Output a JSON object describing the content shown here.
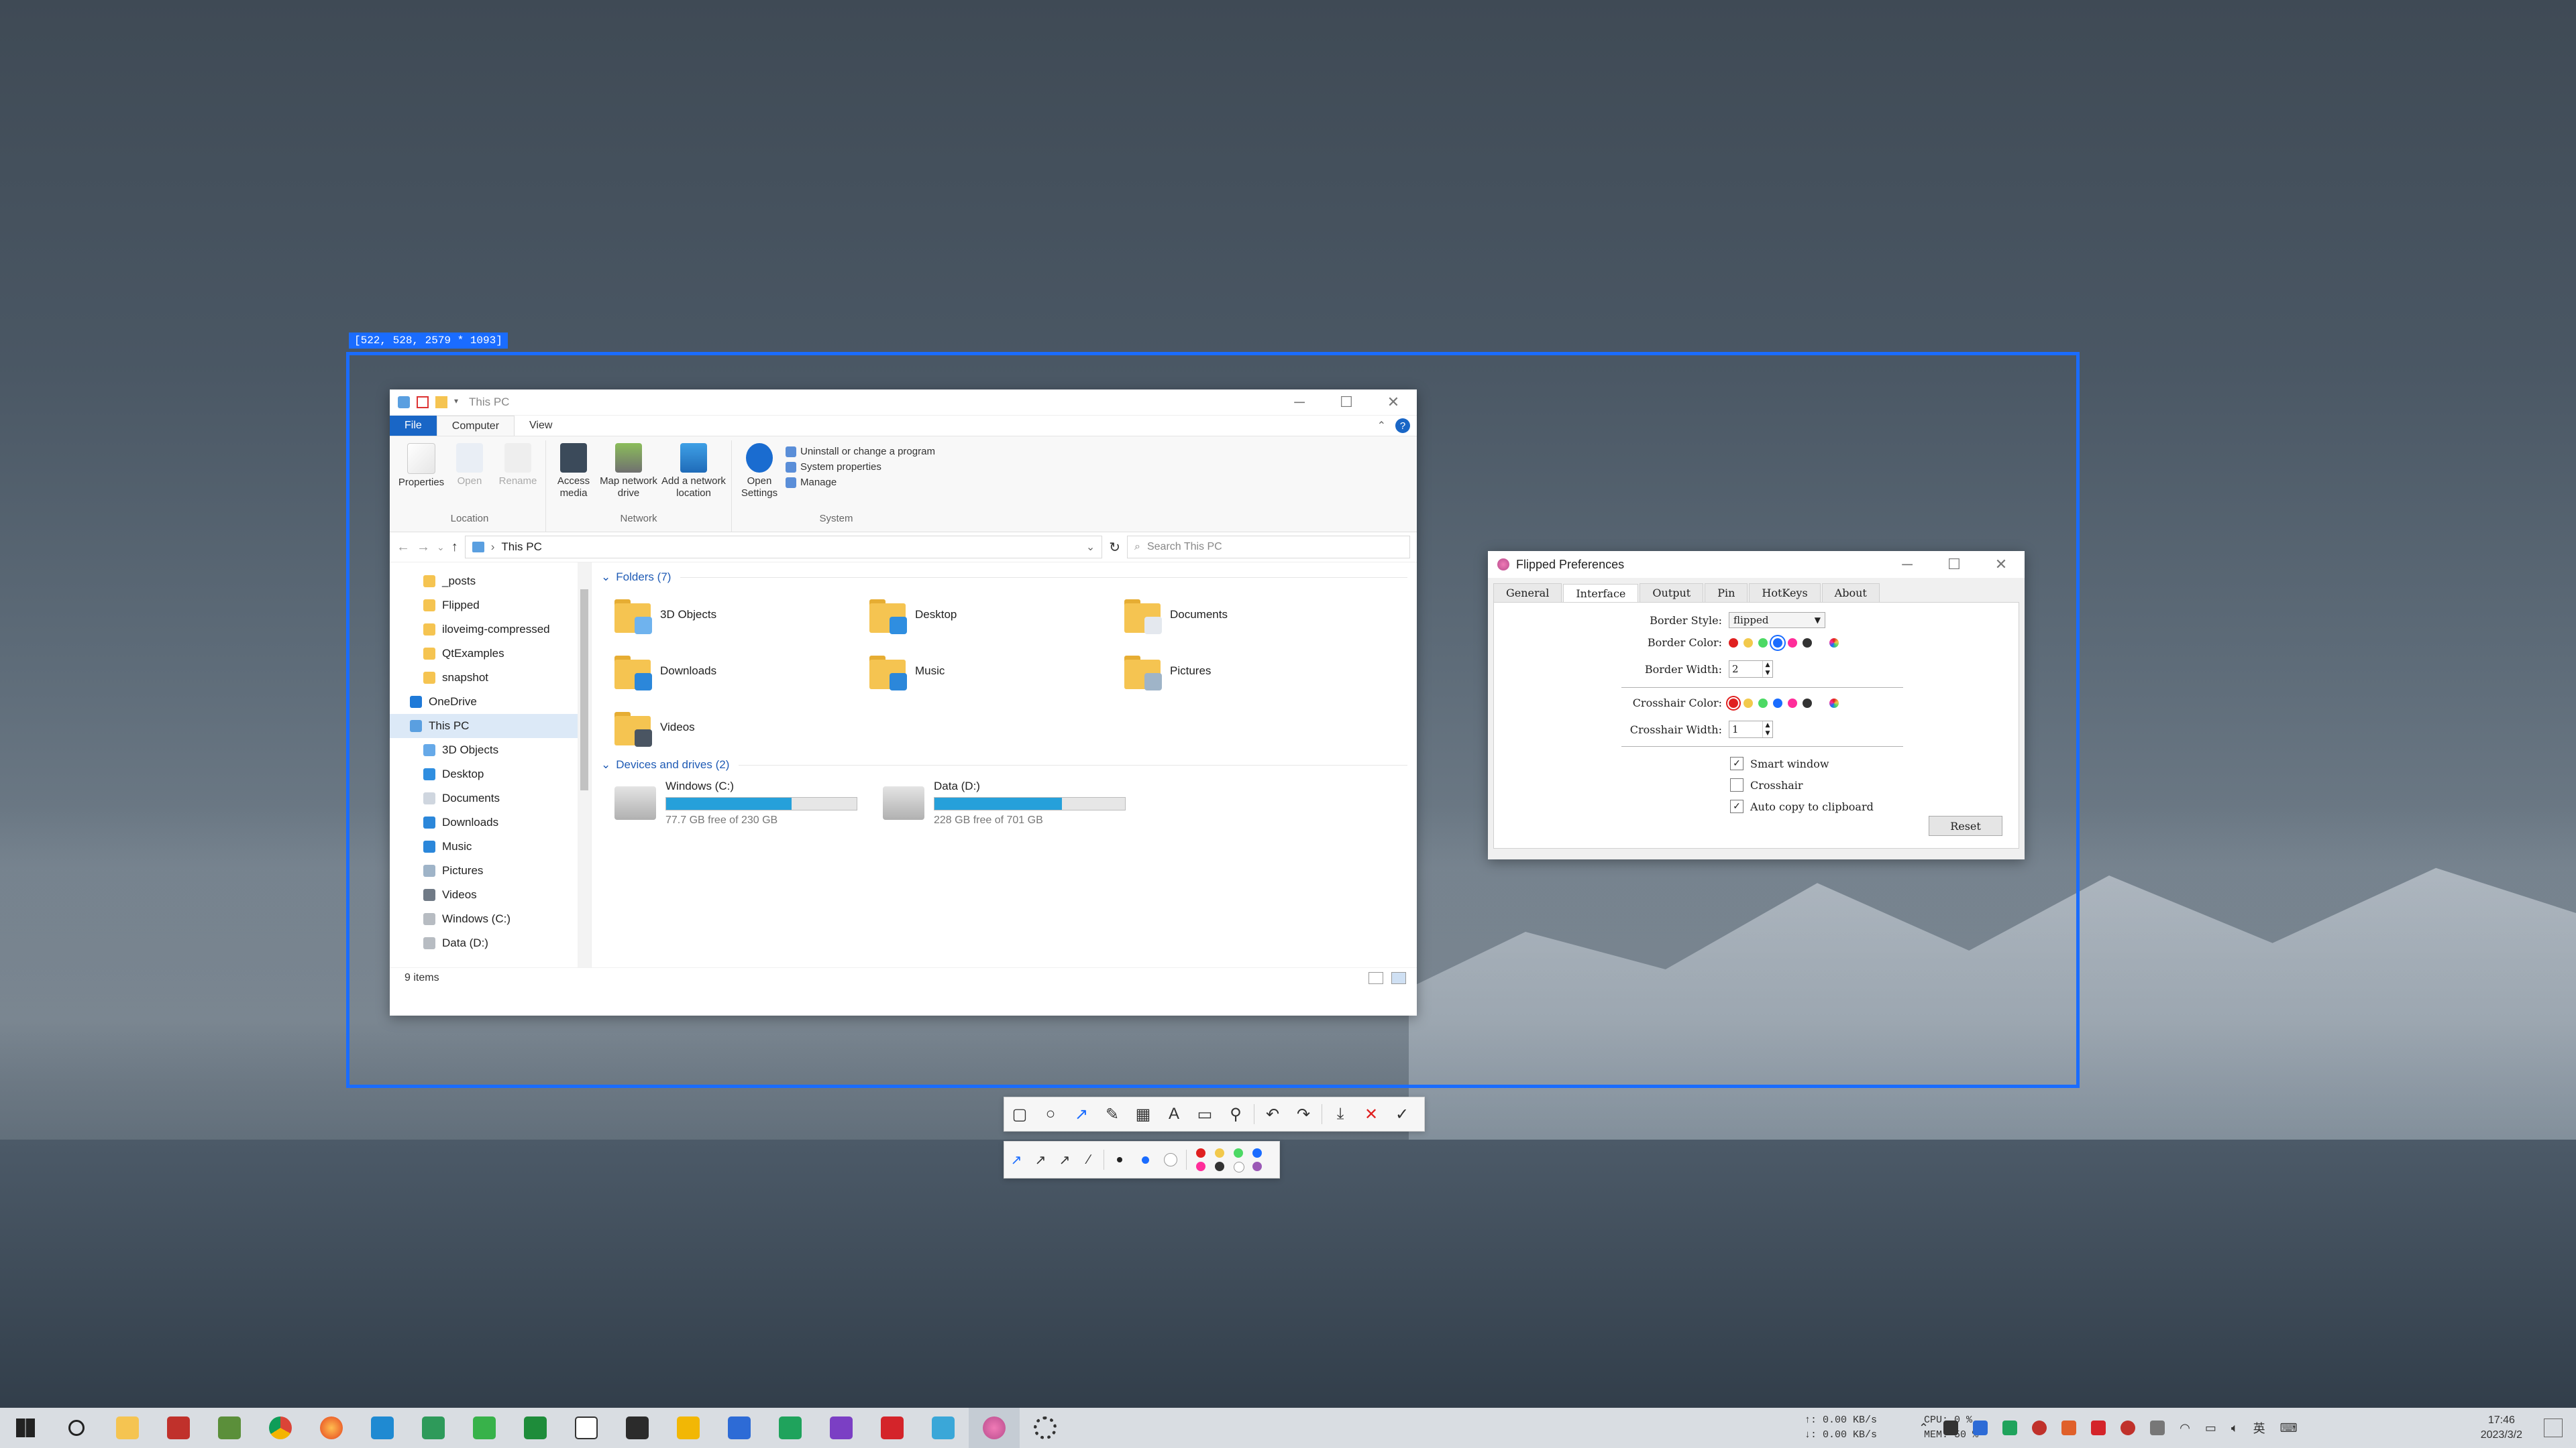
{
  "selection": {
    "label": "[522, 528, 2579 * 1093]",
    "accent": "#1a6cff"
  },
  "explorer": {
    "title": "This PC",
    "ribbon_tabs": [
      "File",
      "Computer",
      "View"
    ],
    "location_group": {
      "label": "Location",
      "buttons": [
        "Properties",
        "Open",
        "Rename"
      ]
    },
    "network_group": {
      "label": "Network",
      "buttons": [
        "Access media",
        "Map network drive",
        "Add a network location"
      ]
    },
    "system_group": {
      "label": "System",
      "open_settings": "Open Settings",
      "links": [
        "Uninstall or change a program",
        "System properties",
        "Manage"
      ]
    },
    "address": "This PC",
    "search_placeholder": "Search This PC",
    "nav": [
      {
        "label": "_posts",
        "indent": 1,
        "color": "#f5c451"
      },
      {
        "label": "Flipped",
        "indent": 1,
        "color": "#f5c451"
      },
      {
        "label": "iloveimg-compressed",
        "indent": 1,
        "color": "#f5c451"
      },
      {
        "label": "QtExamples",
        "indent": 1,
        "color": "#f5c451"
      },
      {
        "label": "snapshot",
        "indent": 1,
        "color": "#f5c451"
      },
      {
        "label": "OneDrive",
        "indent": 0,
        "color": "#1f7ad8"
      },
      {
        "label": "This PC",
        "indent": 0,
        "color": "#5a9fe0",
        "selected": true
      },
      {
        "label": "3D Objects",
        "indent": 1,
        "color": "#66a9e8"
      },
      {
        "label": "Desktop",
        "indent": 1,
        "color": "#2f8ee0"
      },
      {
        "label": "Documents",
        "indent": 1,
        "color": "#cfd6df"
      },
      {
        "label": "Downloads",
        "indent": 1,
        "color": "#2b87da"
      },
      {
        "label": "Music",
        "indent": 1,
        "color": "#2b87da"
      },
      {
        "label": "Pictures",
        "indent": 1,
        "color": "#9fb4c8"
      },
      {
        "label": "Videos",
        "indent": 1,
        "color": "#707a86"
      },
      {
        "label": "Windows (C:)",
        "indent": 1,
        "color": "#b7bcc2"
      },
      {
        "label": "Data (D:)",
        "indent": 1,
        "color": "#b7bcc2"
      }
    ],
    "folders_header": "Folders (7)",
    "folders": [
      {
        "name": "3D Objects",
        "badge": "#6fb3ee"
      },
      {
        "name": "Desktop",
        "badge": "#2f8ee0"
      },
      {
        "name": "Documents",
        "badge": "#e4e8ee"
      },
      {
        "name": "Downloads",
        "badge": "#2b87da"
      },
      {
        "name": "Music",
        "badge": "#2b87da"
      },
      {
        "name": "Pictures",
        "badge": "#9fb4c8"
      },
      {
        "name": "Videos",
        "badge": "#4a5562"
      }
    ],
    "drives_header": "Devices and drives (2)",
    "drives": [
      {
        "name": "Windows (C:)",
        "free": "77.7 GB free of 230 GB",
        "used_fraction": 0.66
      },
      {
        "name": "Data (D:)",
        "free": "228 GB free of 701 GB",
        "used_fraction": 0.67
      }
    ],
    "status": "9 items"
  },
  "prefs": {
    "title": "Flipped Preferences",
    "tabs": [
      "General",
      "Interface",
      "Output",
      "Pin",
      "HotKeys",
      "About"
    ],
    "active_tab": "Interface",
    "border_style_label": "Border Style:",
    "border_style_value": "flipped",
    "border_color_label": "Border Color:",
    "border_width_label": "Border Width:",
    "border_width_value": "2",
    "crosshair_color_label": "Crosshair Color:",
    "crosshair_width_label": "Crosshair Width:",
    "crosshair_width_value": "1",
    "colors": [
      "#e02020",
      "#f2c94c",
      "#4cd964",
      "#1a6cff",
      "#ff2d9a",
      "#333333"
    ],
    "checkboxes": [
      {
        "label": "Smart window",
        "checked": true
      },
      {
        "label": "Crosshair",
        "checked": false
      },
      {
        "label": "Auto copy to clipboard",
        "checked": true
      }
    ],
    "reset_label": "Reset"
  },
  "snip_toolbar": {
    "tools": [
      "rectangle-icon",
      "ellipse-icon",
      "arrow-icon",
      "pencil-icon",
      "mosaic-icon",
      "text-icon",
      "comment-icon",
      "pin-icon",
      "undo-icon",
      "redo-icon",
      "download-icon",
      "close-icon",
      "check-icon"
    ],
    "palette": [
      "#e02020",
      "#f2c94c",
      "#4cd964",
      "#1a6cff",
      "#ff2d9a",
      "#333333",
      "#ffffff",
      "#9b59b6"
    ]
  },
  "taskbar": {
    "net_up": "↑: 0.00 KB/s",
    "net_down": "↓: 0.00 KB/s",
    "cpu": "CPU: 0 %",
    "mem": "MEM: 50 %",
    "time": "17:46",
    "date": "2023/3/2"
  }
}
